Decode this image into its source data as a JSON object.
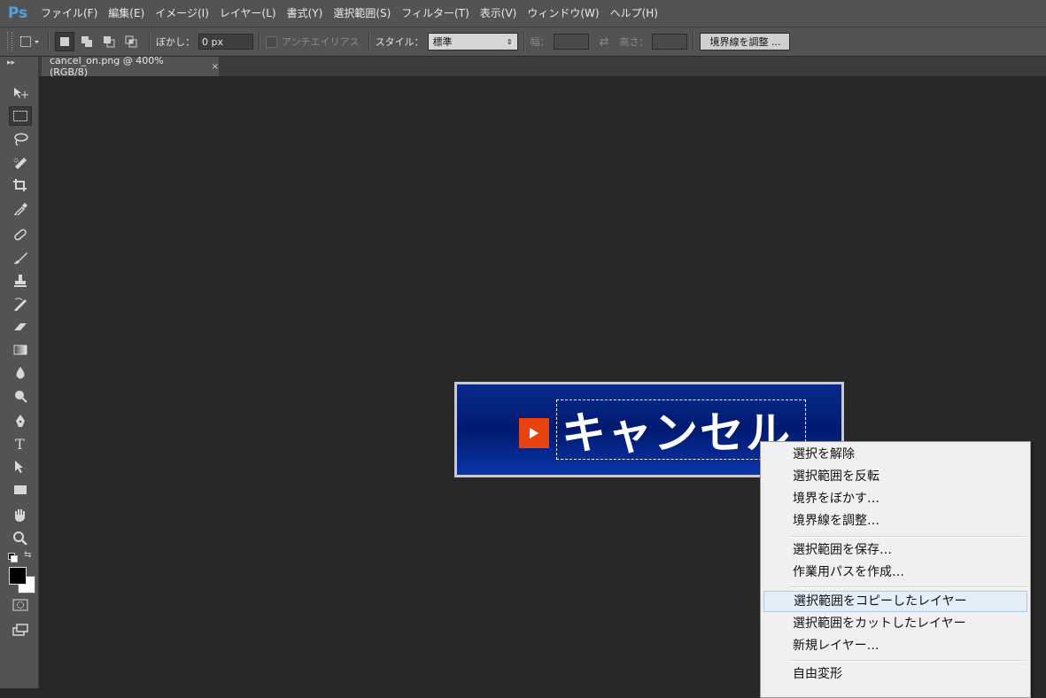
{
  "app": {
    "logo": "Ps"
  },
  "menubar": {
    "items": [
      "ファイル(F)",
      "編集(E)",
      "イメージ(I)",
      "レイヤー(L)",
      "書式(Y)",
      "選択範囲(S)",
      "フィルター(T)",
      "表示(V)",
      "ウィンドウ(W)",
      "ヘルプ(H)"
    ]
  },
  "options": {
    "feather_label": "ぼかし：",
    "feather_value": "0 px",
    "antialias_label": "アンチエイリアス",
    "style_label": "スタイル：",
    "style_value": "標準",
    "width_label": "幅：",
    "height_label": "高さ：",
    "refine_edge": "境界線を調整 ..."
  },
  "document": {
    "tab_title": "cancel_on.png @ 400% (RGB/8)",
    "tab_close": "×",
    "image_text": "キャンセル"
  },
  "toolbar": {
    "tools": [
      "move-icon",
      "rect-marquee-icon",
      "lasso-icon",
      "quick-select-icon",
      "crop-icon",
      "eyedropper-icon",
      "healing-brush-icon",
      "brush-icon",
      "clone-stamp-icon",
      "history-brush-icon",
      "eraser-icon",
      "gradient-icon",
      "blur-icon",
      "dodge-icon",
      "pen-icon",
      "type-icon",
      "path-select-icon",
      "rectangle-icon",
      "hand-icon",
      "zoom-icon"
    ],
    "foreground_color": "#000000",
    "background_color": "#ffffff"
  },
  "context_menu": {
    "group1": [
      "選択を解除",
      "選択範囲を反転",
      "境界をぼかす…",
      "境界線を調整…"
    ],
    "group2": [
      "選択範囲を保存…",
      "作業用パスを作成…"
    ],
    "group3": [
      "選択範囲をコピーしたレイヤー",
      "選択範囲をカットしたレイヤー",
      "新規レイヤー…"
    ],
    "group4": [
      "自由変形"
    ]
  }
}
